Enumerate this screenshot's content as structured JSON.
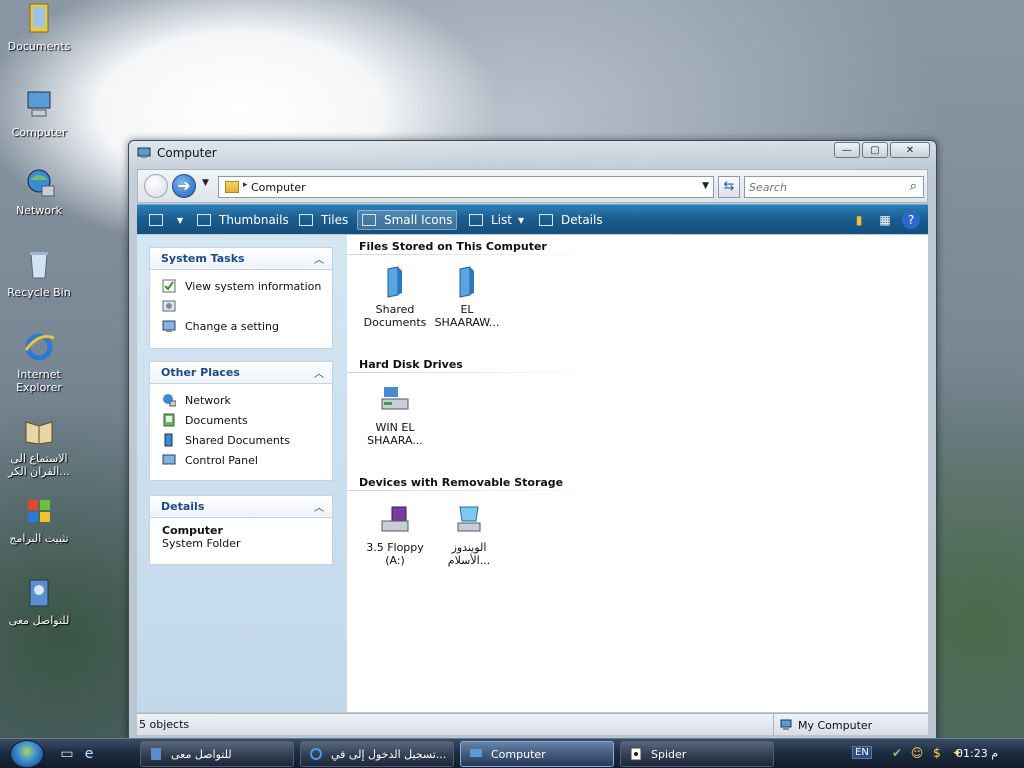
{
  "desktop": {
    "icons": [
      {
        "label": "Documents",
        "icon": "documents-icon"
      },
      {
        "label": "Computer",
        "icon": "computer-icon"
      },
      {
        "label": "Network",
        "icon": "network-icon"
      },
      {
        "label": "Recycle Bin",
        "icon": "recycle-bin-icon"
      },
      {
        "label": "Internet Explorer",
        "icon": "internet-explorer-icon"
      },
      {
        "label": "الاستماع الى القران الكر...",
        "icon": "quran-icon"
      },
      {
        "label": "تثبيت البرامج",
        "icon": "windows-flag-icon"
      },
      {
        "label": "للتواصل معى",
        "icon": "contact-icon"
      }
    ]
  },
  "window": {
    "title": "Computer",
    "address": {
      "crumb": "Computer"
    },
    "search": {
      "placeholder": "Search"
    },
    "toolbar": {
      "thumbnails": "Thumbnails",
      "tiles": "Tiles",
      "small_icons": "Small Icons",
      "list": "List",
      "details": "Details"
    },
    "left_pane": {
      "system_tasks": {
        "title": "System Tasks",
        "items": [
          "View system information",
          "",
          "Change a setting"
        ]
      },
      "other_places": {
        "title": "Other Places",
        "items": [
          "Network",
          "Documents",
          "Shared Documents",
          "Control Panel"
        ]
      },
      "details": {
        "title": "Details",
        "name": "Computer",
        "type": "System Folder"
      }
    },
    "groups": {
      "files": {
        "title": "Files Stored on This Computer",
        "items": [
          {
            "line1": "Shared",
            "line2": "Documents"
          },
          {
            "line1": "EL",
            "line2": "SHAARAW..."
          }
        ]
      },
      "drives": {
        "title": "Hard Disk Drives",
        "items": [
          {
            "line1": "WIN EL",
            "line2": "SHAARA..."
          }
        ]
      },
      "removable": {
        "title": "Devices with Removable Storage",
        "items": [
          {
            "line1": "3.5 Floppy",
            "line2": "(A:)"
          },
          {
            "line1": "الويندوز",
            "line2": "الأسلام..."
          }
        ]
      }
    },
    "status": {
      "count": "5 objects",
      "location": "My Computer"
    }
  },
  "taskbar": {
    "buttons": [
      {
        "label": "للتواصل معى"
      },
      {
        "label": "تسجيل الدخول إلى في..."
      },
      {
        "label": "Computer"
      },
      {
        "label": "Spider"
      }
    ],
    "lang": "EN",
    "clock": "م 01:23"
  },
  "colors": {
    "command_bar": "#1b5c8f",
    "task_header_text": "#1a4a8a",
    "taskbar": "#1d2b40"
  }
}
